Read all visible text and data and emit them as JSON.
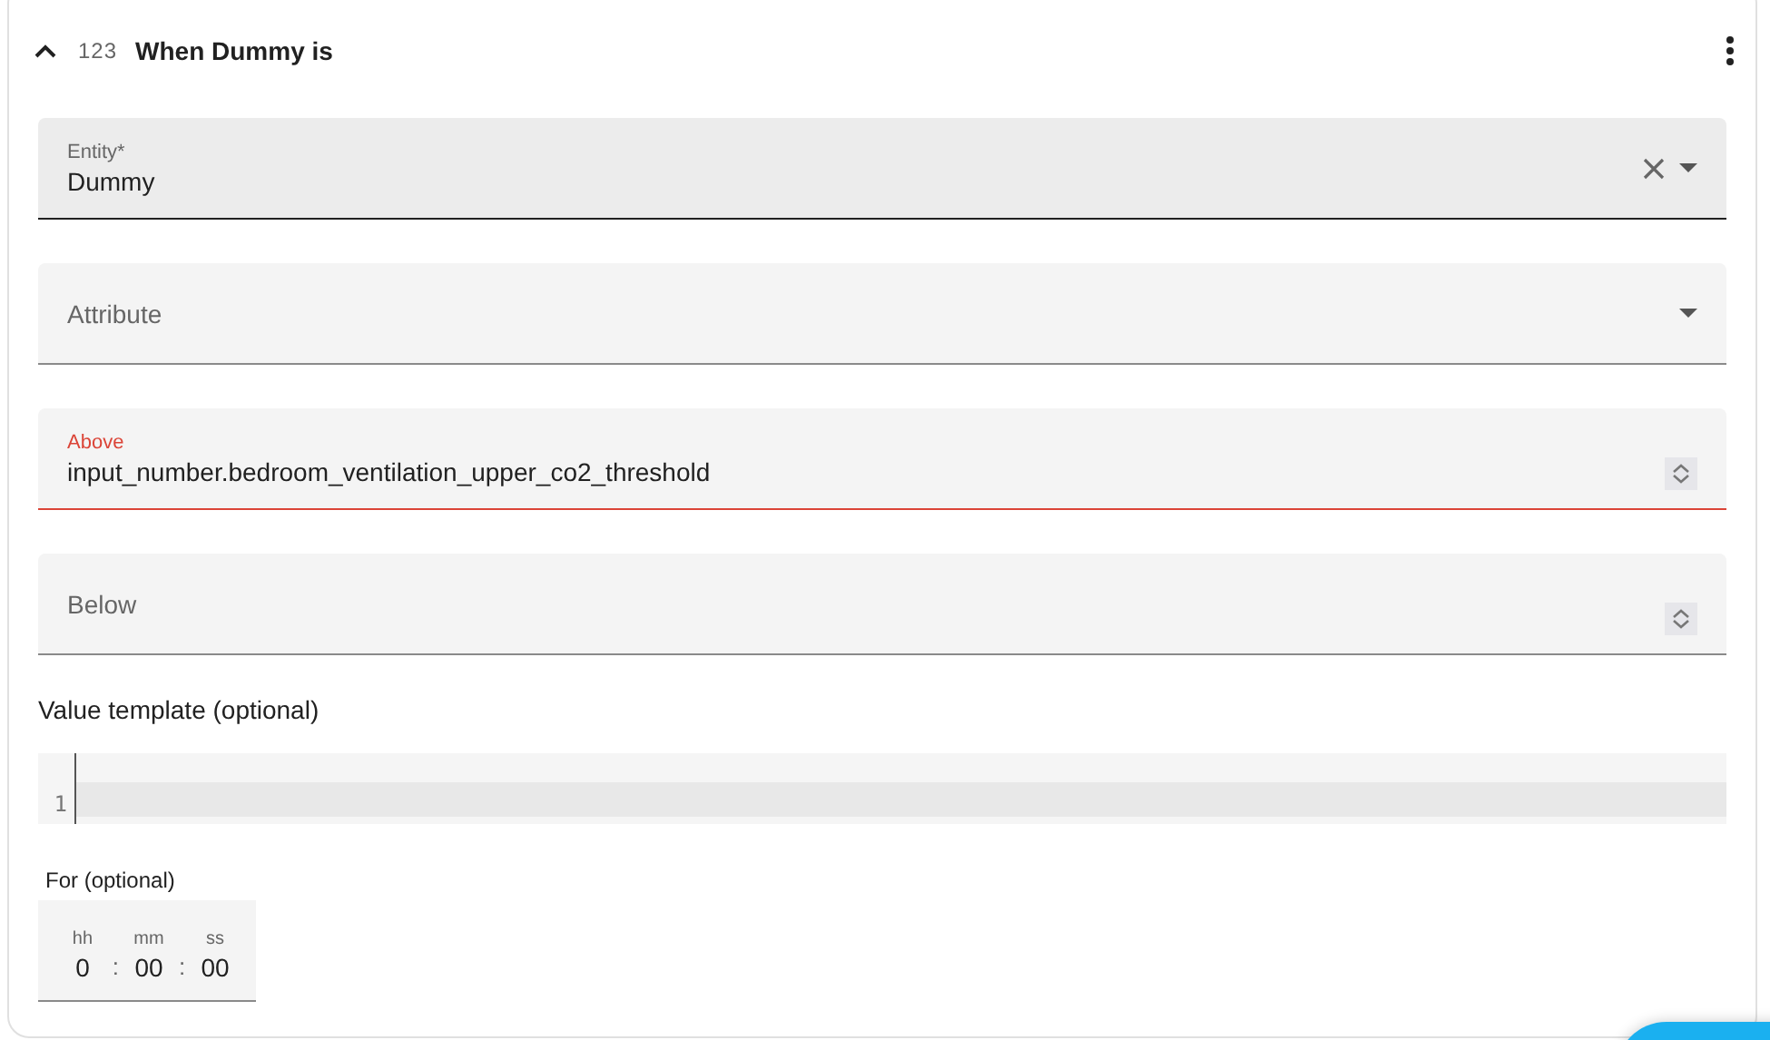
{
  "card": {
    "expanded": true,
    "type_icon_text": "123",
    "title": "When Dummy is"
  },
  "fields": [
    {
      "kind": "select",
      "label": "Entity*",
      "value": "Dummy",
      "focused": true,
      "invalid": false,
      "clearable": true
    },
    {
      "kind": "select",
      "label": "Attribute",
      "focused": false,
      "invalid": false,
      "clearable": false
    },
    {
      "kind": "number",
      "label": "Above",
      "value": "input_number.bedroom_ventilation_upper_co2_threshold",
      "focused": false,
      "invalid": true,
      "clearable": false
    },
    {
      "kind": "number",
      "label": "Below",
      "focused": false,
      "invalid": false,
      "clearable": false
    }
  ],
  "template": {
    "label": "Value template (optional)",
    "line_numbers": [
      "1"
    ]
  },
  "duration": {
    "label": "For (optional)",
    "separator": ":",
    "units": [
      {
        "label": "hh",
        "value": "0"
      },
      {
        "label": "mm",
        "value": "00"
      },
      {
        "label": "ss",
        "value": "00"
      }
    ]
  }
}
